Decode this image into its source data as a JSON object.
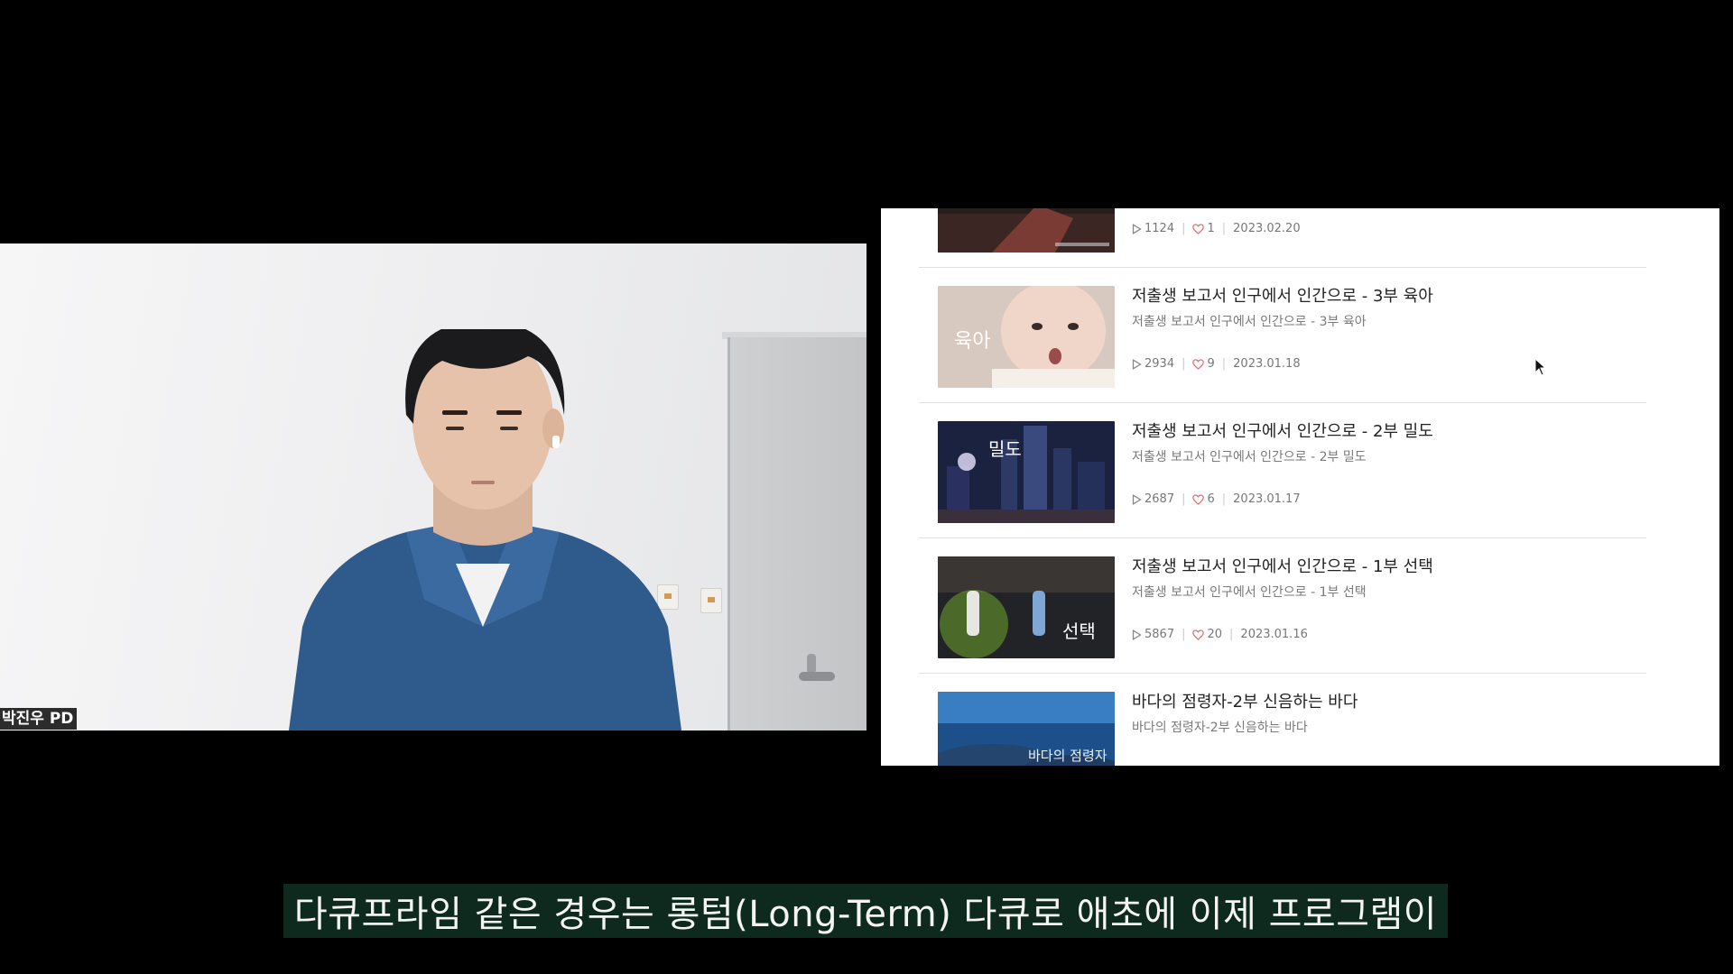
{
  "webcam": {
    "participant_name": "박진우 PD"
  },
  "list": {
    "items": [
      {
        "title": "",
        "subtitle": "",
        "views": "1124",
        "likes": "1",
        "date": "2023.02.20"
      },
      {
        "title": "저출생 보고서 인구에서 인간으로 - 3부 육아",
        "subtitle": "저출생 보고서 인구에서 인간으로 - 3부 육아",
        "thumb_text": "육아",
        "views": "2934",
        "likes": "9",
        "date": "2023.01.18"
      },
      {
        "title": "저출생 보고서 인구에서 인간으로 - 2부 밀도",
        "subtitle": "저출생 보고서 인구에서 인간으로 - 2부 밀도",
        "thumb_text": "밀도",
        "views": "2687",
        "likes": "6",
        "date": "2023.01.17"
      },
      {
        "title": "저출생 보고서 인구에서 인간으로 - 1부 선택",
        "subtitle": "저출생 보고서 인구에서 인간으로 - 1부 선택",
        "thumb_text": "선택",
        "views": "5867",
        "likes": "20",
        "date": "2023.01.16"
      },
      {
        "title": "바다의 점령자-2부 신음하는 바다",
        "subtitle": "바다의 점령자-2부 신음하는 바다",
        "thumb_text": "바다의 점령자",
        "views": "",
        "likes": "",
        "date": ""
      }
    ]
  },
  "icons": {
    "views": "play-outline-icon",
    "likes": "heart-outline-icon",
    "cursor": "mouse-cursor-icon"
  },
  "colors": {
    "subtitle_bg": "#0e2a1f",
    "heart": "#e0707a",
    "page_bg": "#000000"
  },
  "subtitle": {
    "text": "다큐프라임 같은 경우는 롱텀(Long-Term) 다큐로 애초에 이제 프로그램이"
  }
}
